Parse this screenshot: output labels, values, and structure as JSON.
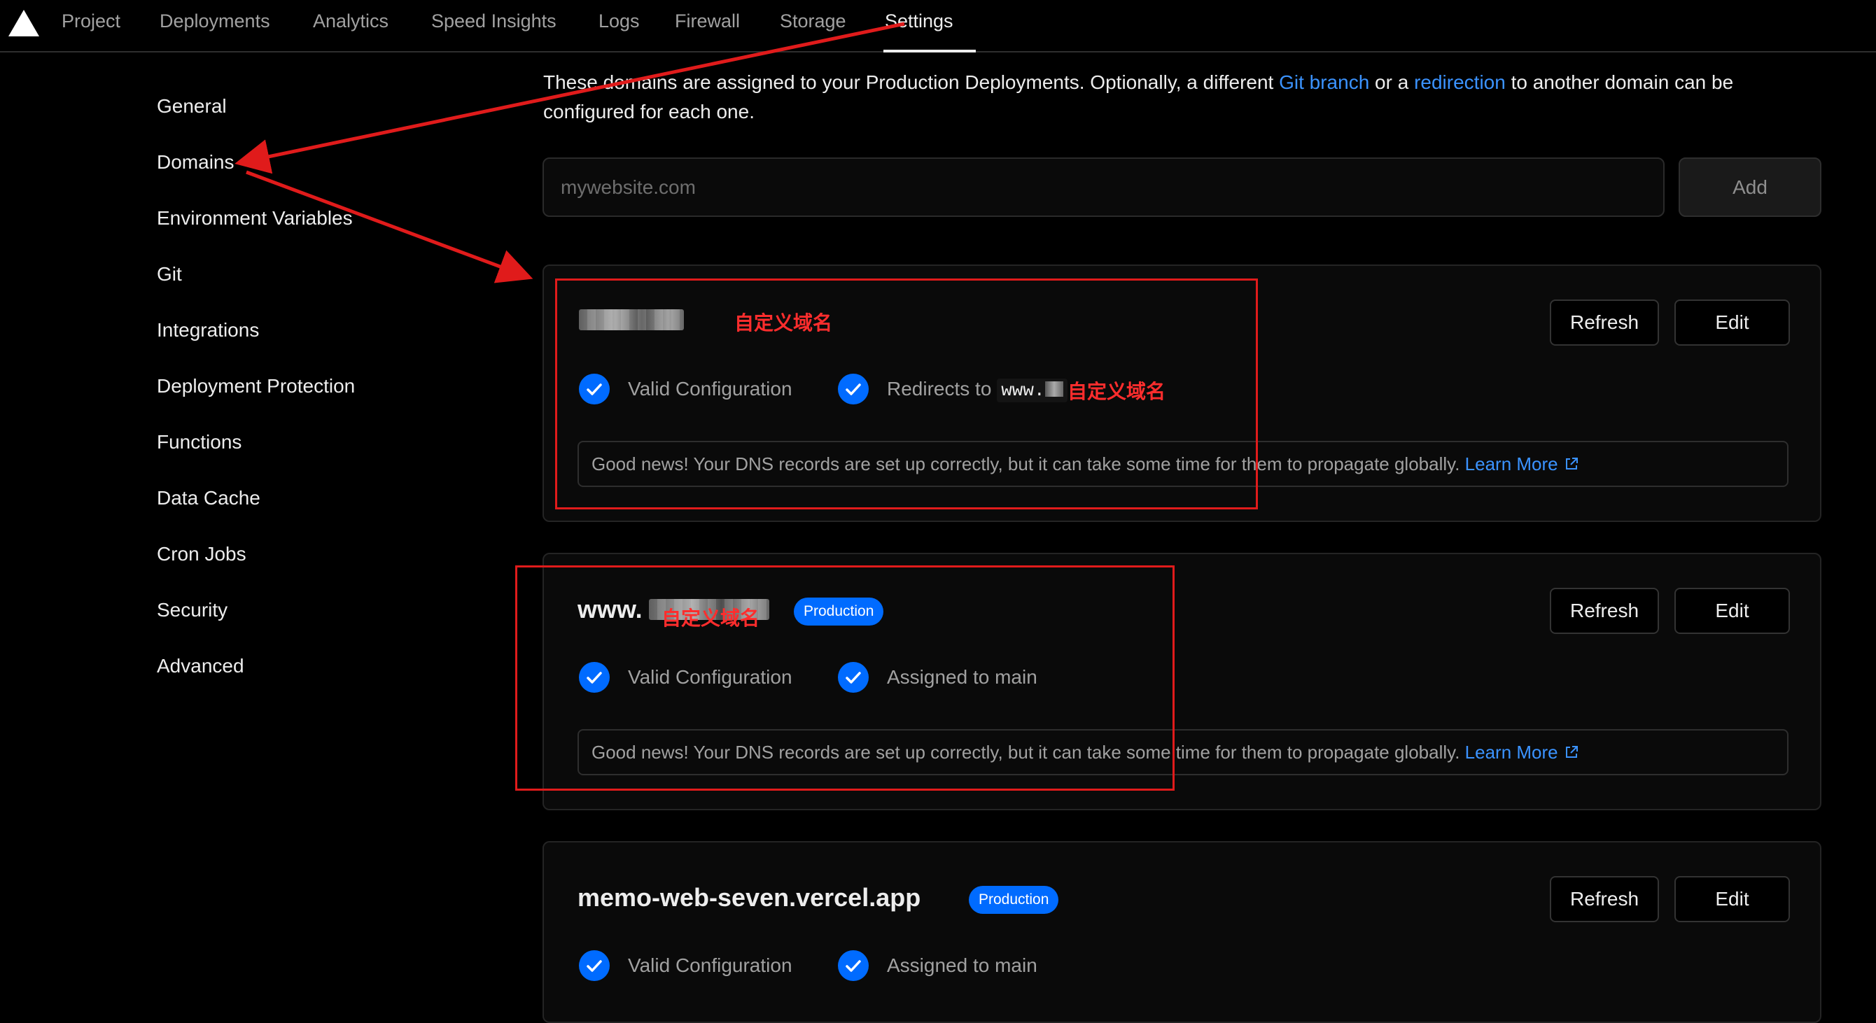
{
  "nav": {
    "tabs": [
      "Project",
      "Deployments",
      "Analytics",
      "Speed Insights",
      "Logs",
      "Firewall",
      "Storage",
      "Settings"
    ],
    "active_tab": "Settings"
  },
  "sidebar": {
    "items": [
      "General",
      "Domains",
      "Environment Variables",
      "Git",
      "Integrations",
      "Deployment Protection",
      "Functions",
      "Data Cache",
      "Cron Jobs",
      "Security",
      "Advanced"
    ]
  },
  "intro": {
    "text_1": "These domains are assigned to your Production Deployments. Optionally, a different ",
    "link_1": "Git branch",
    "text_2": " or a ",
    "link_2": "redirection",
    "text_3": " to another domain can be configured for each one."
  },
  "add_domain": {
    "placeholder": "mywebsite.com",
    "button": "Add"
  },
  "domains": [
    {
      "title": "",
      "annotation": "自定义域名",
      "refresh": "Refresh",
      "edit": "Edit",
      "status_1": "Valid Configuration",
      "status_2": "Redirects to",
      "redirect_target": "www.",
      "redirect_annotation": "自定义域名",
      "note": "Good news! Your DNS records are set up correctly, but it can take some time for them to propagate globally.",
      "learn_more": "Learn More"
    },
    {
      "title": "www.",
      "annotation": "自定义域名",
      "badge": "Production",
      "refresh": "Refresh",
      "edit": "Edit",
      "status_1": "Valid Configuration",
      "status_2": "Assigned to main",
      "note": "Good news! Your DNS records are set up correctly, but it can take some time for them to propagate globally.",
      "learn_more": "Learn More"
    },
    {
      "title": "memo-web-seven.vercel.app",
      "badge": "Production",
      "refresh": "Refresh",
      "edit": "Edit",
      "status_1": "Valid Configuration",
      "status_2": "Assigned to main"
    }
  ],
  "colors": {
    "background": "#000000",
    "link": "#3b93ff",
    "badge": "#006bff",
    "check": "#006bff",
    "annotation": "#e01b1b"
  }
}
